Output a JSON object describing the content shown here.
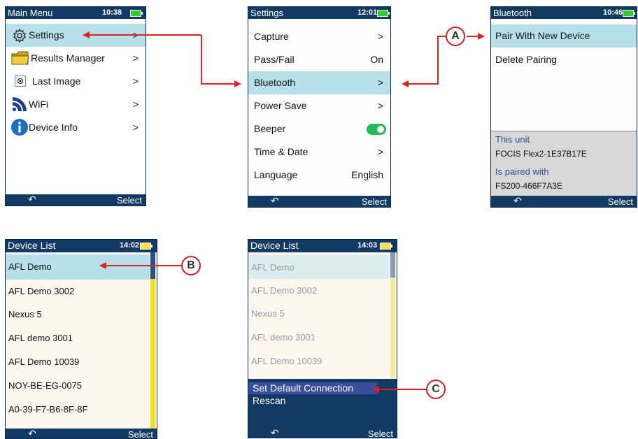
{
  "screen_main": {
    "title": "Main Menu",
    "time": "10:38",
    "items": [
      {
        "label": "Settings",
        "value": ">"
      },
      {
        "label": "Results Manager",
        "value": ">"
      },
      {
        "label": "Last Image",
        "value": ">"
      },
      {
        "label": "WiFi",
        "value": ">"
      },
      {
        "label": "Device Info",
        "value": ">"
      }
    ],
    "back": "↶",
    "select": "Select"
  },
  "screen_settings": {
    "title": "Settings",
    "time": "12:01",
    "items": [
      {
        "label": "Capture",
        "value": ">"
      },
      {
        "label": "Pass/Fail",
        "value": "On"
      },
      {
        "label": "Bluetooth",
        "value": ">"
      },
      {
        "label": "Power Save",
        "value": ">"
      },
      {
        "label": "Beeper",
        "value": ""
      },
      {
        "label": "Time & Date",
        "value": ">"
      },
      {
        "label": "Language",
        "value": "English"
      }
    ],
    "back": "↶",
    "select": "Select"
  },
  "screen_bluetooth": {
    "title": "Bluetooth",
    "time": "10:46",
    "items": [
      {
        "label": "Pair With New Device"
      },
      {
        "label": "Delete Pairing"
      }
    ],
    "this_unit_label": "This unit",
    "this_unit_value": "FOCIS Flex2-1E37B17E",
    "paired_label": "Is paired with",
    "paired_value": "FS200-466F7A3E",
    "back": "↶",
    "select": "Select"
  },
  "screen_devices1": {
    "title": "Device List",
    "time": "14:02",
    "items": [
      "AFL Demo",
      "AFL Demo 3002",
      "Nexus 5",
      "AFL demo 3001",
      "AFL Demo 10039",
      "NOY-BE-EG-0075",
      "A0-39-F7-B6-8F-8F"
    ],
    "back": "↶",
    "select": "Select"
  },
  "screen_devices2": {
    "title": "Device List",
    "time": "14:03",
    "items": [
      "AFL Demo",
      "AFL Demo 3002",
      "Nexus 5",
      "AFL demo 3001",
      "AFL Demo 10039"
    ],
    "menu": [
      "Set Default Connection",
      "Rescan"
    ],
    "back": "↶",
    "select": "Select"
  },
  "callouts": {
    "a": "A",
    "b": "B",
    "c": "C"
  },
  "colors": {
    "title_bar": "#123a62",
    "highlight": "#b8e0ea",
    "arrow": "#dd2222",
    "toggle": "#22bb55"
  }
}
